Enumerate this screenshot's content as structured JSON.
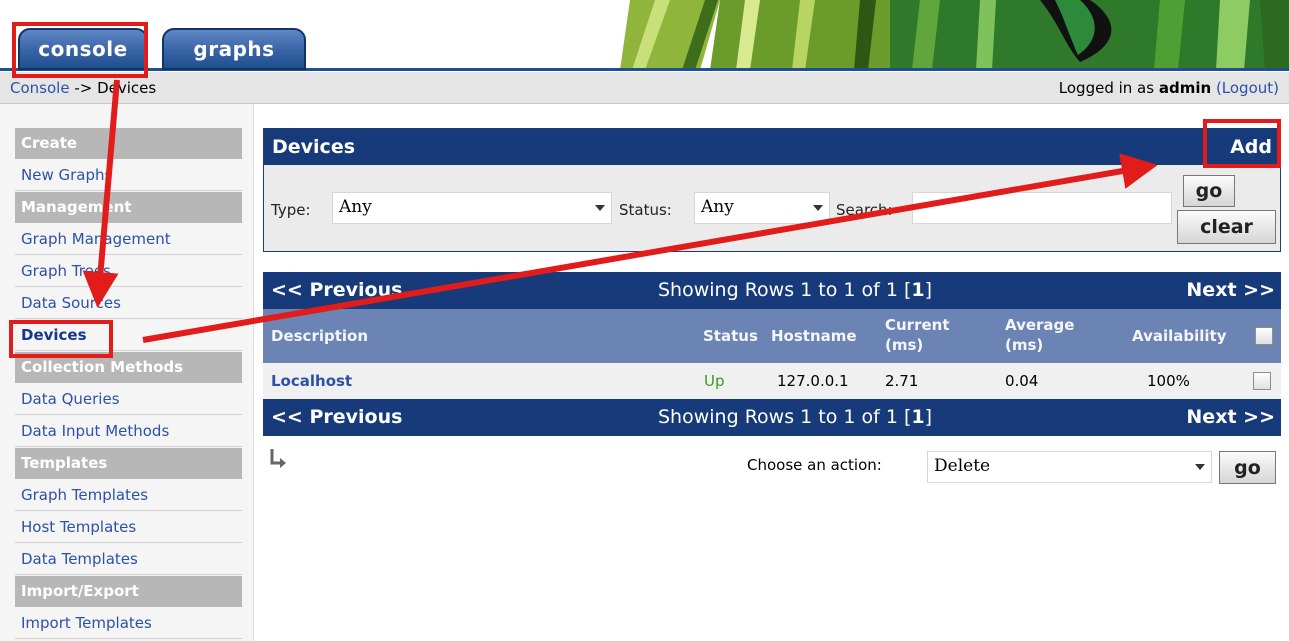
{
  "tabs": {
    "console": "console",
    "graphs": "graphs"
  },
  "breadcrumb": {
    "root": "Console",
    "separator": " -> ",
    "current": "Devices"
  },
  "login": {
    "prefix": "Logged in as ",
    "user": "admin",
    "logout": "(Logout)"
  },
  "sidebar": [
    {
      "kind": "section",
      "label": "Create"
    },
    {
      "kind": "item",
      "label": "New Graphs"
    },
    {
      "kind": "section",
      "label": "Management"
    },
    {
      "kind": "item",
      "label": "Graph Management"
    },
    {
      "kind": "item",
      "label": "Graph Trees"
    },
    {
      "kind": "item",
      "label": "Data Sources"
    },
    {
      "kind": "item",
      "label": "Devices",
      "active": true
    },
    {
      "kind": "section",
      "label": "Collection Methods"
    },
    {
      "kind": "item",
      "label": "Data Queries"
    },
    {
      "kind": "item",
      "label": "Data Input Methods"
    },
    {
      "kind": "section",
      "label": "Templates"
    },
    {
      "kind": "item",
      "label": "Graph Templates"
    },
    {
      "kind": "item",
      "label": "Host Templates"
    },
    {
      "kind": "item",
      "label": "Data Templates"
    },
    {
      "kind": "section",
      "label": "Import/Export"
    },
    {
      "kind": "item",
      "label": "Import Templates"
    }
  ],
  "filter": {
    "title": "Devices",
    "add": "Add",
    "type_label": "Type:",
    "type_value": "Any",
    "status_label": "Status:",
    "status_value": "Any",
    "search_label": "Search:",
    "search_value": "",
    "go": "go",
    "clear": "clear"
  },
  "table": {
    "prev": "<< Previous",
    "next": "Next >>",
    "showing": "Showing Rows 1 to 1 of 1 [",
    "page": "1",
    "showing_end": "]",
    "columns": {
      "description": "Description",
      "status": "Status",
      "hostname": "Hostname",
      "current_1": "Current",
      "current_2": "(ms)",
      "average_1": "Average",
      "average_2": "(ms)",
      "availability": "Availability"
    },
    "rows": [
      {
        "description": "Localhost",
        "status": "Up",
        "hostname": "127.0.0.1",
        "current": "2.71",
        "average": "0.04",
        "availability": "100%"
      }
    ]
  },
  "action": {
    "label": "Choose an action:",
    "value": "Delete",
    "go": "go"
  },
  "colors": {
    "navy": "#173a7a",
    "header_blue": "#6b84b3",
    "link": "#2c51a7",
    "status_up": "#3a9a2c",
    "annotation": "#e21b1b"
  }
}
